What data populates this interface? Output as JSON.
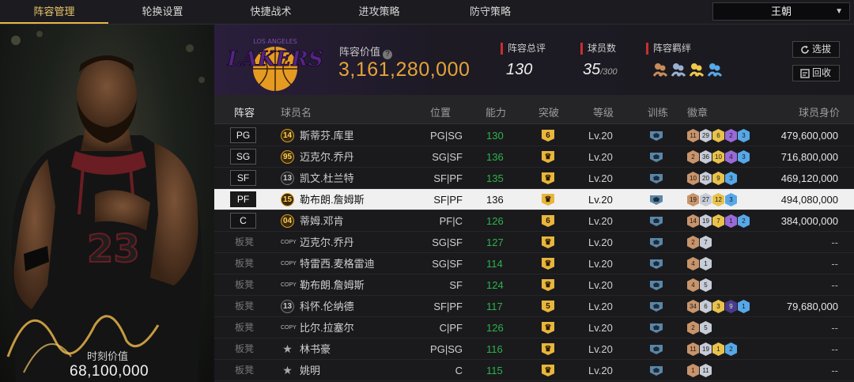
{
  "nav": {
    "tabs": [
      "阵容管理",
      "轮换设置",
      "快捷战术",
      "进攻策略",
      "防守策略"
    ],
    "active_index": 0
  },
  "team_select": {
    "value": "王朝"
  },
  "left_panel": {
    "market_value_label": "时刻价值",
    "market_value": "68,100,000"
  },
  "summary": {
    "logo_text": "LAKERS",
    "logo_small": "LOS ANGELES",
    "lineup_value_label": "阵容价值",
    "lineup_value": "3,161,280,000",
    "rating_label": "阵容总评",
    "rating": "130",
    "players_label": "球员数",
    "players": "35",
    "players_max": "/300",
    "bond_label": "阵容羁绊",
    "buttons": {
      "select": "选拔",
      "recycle": "回收"
    }
  },
  "columns": [
    "阵容",
    "球员名",
    "位置",
    "能力",
    "突破",
    "等级",
    "训练",
    "徽章",
    "球员身价"
  ],
  "colors": {
    "accent": "#e9b54a",
    "ability_green": "#2db34a",
    "stat_red": "#c9302c",
    "lakers_purple": "#552583",
    "lakers_gold": "#fdb927"
  },
  "rows": [
    {
      "slot": "PG",
      "bench": false,
      "jersey": "14",
      "jersey_style": "gold",
      "name": "斯蒂芬.库里",
      "pos": "PG|SG",
      "ability": "130",
      "breakthrough": "6",
      "level": "Lv.20",
      "badges": [
        {
          "n": "11",
          "c": "bronze"
        },
        {
          "n": "29",
          "c": "silver"
        },
        {
          "n": "6",
          "c": "gold"
        },
        {
          "n": "2",
          "c": "purple"
        },
        {
          "n": "3",
          "c": "blue"
        }
      ],
      "worth": "479,600,000"
    },
    {
      "slot": "SG",
      "bench": false,
      "jersey": "95",
      "jersey_style": "gold",
      "name": "迈克尔.乔丹",
      "pos": "SG|SF",
      "ability": "136",
      "breakthrough": "crown",
      "level": "Lv.20",
      "badges": [
        {
          "n": "2",
          "c": "bronze"
        },
        {
          "n": "36",
          "c": "silver"
        },
        {
          "n": "10",
          "c": "gold"
        },
        {
          "n": "4",
          "c": "purple"
        },
        {
          "n": "3",
          "c": "blue"
        }
      ],
      "worth": "716,800,000"
    },
    {
      "slot": "SF",
      "bench": false,
      "jersey": "13",
      "jersey_style": "gray",
      "name": "凯文.杜兰特",
      "pos": "SF|PF",
      "ability": "135",
      "breakthrough": "crown",
      "level": "Lv.20",
      "badges": [
        {
          "n": "10",
          "c": "bronze"
        },
        {
          "n": "20",
          "c": "silver"
        },
        {
          "n": "9",
          "c": "gold"
        },
        {
          "n": "3",
          "c": "blue"
        }
      ],
      "worth": "469,120,000"
    },
    {
      "slot": "PF",
      "bench": false,
      "jersey": "15",
      "jersey_style": "gold",
      "name": "勒布朗.詹姆斯",
      "pos": "SF|PF",
      "ability": "136",
      "breakthrough": "crown",
      "level": "Lv.20",
      "badges": [
        {
          "n": "19",
          "c": "bronze"
        },
        {
          "n": "27",
          "c": "silver"
        },
        {
          "n": "12",
          "c": "gold"
        },
        {
          "n": "3",
          "c": "blue"
        }
      ],
      "worth": "494,080,000",
      "highlight": true
    },
    {
      "slot": "C",
      "bench": false,
      "jersey": "04",
      "jersey_style": "gold",
      "name": "蒂姆.邓肯",
      "pos": "PF|C",
      "ability": "126",
      "breakthrough": "6",
      "level": "Lv.20",
      "badges": [
        {
          "n": "14",
          "c": "bronze"
        },
        {
          "n": "19",
          "c": "silver"
        },
        {
          "n": "7",
          "c": "gold"
        },
        {
          "n": "1",
          "c": "purple"
        },
        {
          "n": "2",
          "c": "blue"
        }
      ],
      "worth": "384,000,000"
    },
    {
      "slot": "板凳",
      "bench": true,
      "jersey": "COPY",
      "jersey_style": "copy",
      "name": "迈克尔.乔丹",
      "pos": "SG|SF",
      "ability": "127",
      "breakthrough": "crown",
      "level": "Lv.20",
      "badges": [
        {
          "n": "2",
          "c": "bronze"
        },
        {
          "n": "7",
          "c": "silver"
        }
      ],
      "worth": "--"
    },
    {
      "slot": "板凳",
      "bench": true,
      "jersey": "COPY",
      "jersey_style": "copy",
      "name": "特雷西.麦格雷迪",
      "pos": "SG|SF",
      "ability": "114",
      "breakthrough": "crown",
      "level": "Lv.20",
      "badges": [
        {
          "n": "4",
          "c": "bronze"
        },
        {
          "n": "1",
          "c": "silver"
        }
      ],
      "worth": "--"
    },
    {
      "slot": "板凳",
      "bench": true,
      "jersey": "COPY",
      "jersey_style": "copy",
      "name": "勒布朗.詹姆斯",
      "pos": "SF",
      "ability": "124",
      "breakthrough": "crown",
      "level": "Lv.20",
      "badges": [
        {
          "n": "4",
          "c": "bronze"
        },
        {
          "n": "5",
          "c": "silver"
        }
      ],
      "worth": "--"
    },
    {
      "slot": "板凳",
      "bench": true,
      "jersey": "13",
      "jersey_style": "gray",
      "name": "科怀.伦纳德",
      "pos": "SF|PF",
      "ability": "117",
      "breakthrough": "5",
      "level": "Lv.20",
      "badges": [
        {
          "n": "34",
          "c": "bronze"
        },
        {
          "n": "6",
          "c": "silver"
        },
        {
          "n": "3",
          "c": "gold"
        },
        {
          "n": "9",
          "c": "dpurple"
        },
        {
          "n": "1",
          "c": "blue"
        }
      ],
      "worth": "79,680,000"
    },
    {
      "slot": "板凳",
      "bench": true,
      "jersey": "COPY",
      "jersey_style": "copy",
      "name": "比尔.拉塞尔",
      "pos": "C|PF",
      "ability": "126",
      "breakthrough": "crown",
      "level": "Lv.20",
      "badges": [
        {
          "n": "2",
          "c": "bronze"
        },
        {
          "n": "5",
          "c": "silver"
        }
      ],
      "worth": "--"
    },
    {
      "slot": "板凳",
      "bench": true,
      "jersey": "★",
      "jersey_style": "star",
      "name": "林书豪",
      "pos": "PG|SG",
      "ability": "116",
      "breakthrough": "crown",
      "level": "Lv.20",
      "badges": [
        {
          "n": "11",
          "c": "bronze"
        },
        {
          "n": "19",
          "c": "silver"
        },
        {
          "n": "1",
          "c": "gold"
        },
        {
          "n": "2",
          "c": "blue"
        }
      ],
      "worth": "--"
    },
    {
      "slot": "板凳",
      "bench": true,
      "jersey": "★",
      "jersey_style": "star",
      "name": "姚明",
      "pos": "C",
      "ability": "115",
      "breakthrough": "crown",
      "level": "Lv.20",
      "badges": [
        {
          "n": "1",
          "c": "bronze"
        },
        {
          "n": "11",
          "c": "silver"
        }
      ],
      "worth": "--"
    }
  ]
}
